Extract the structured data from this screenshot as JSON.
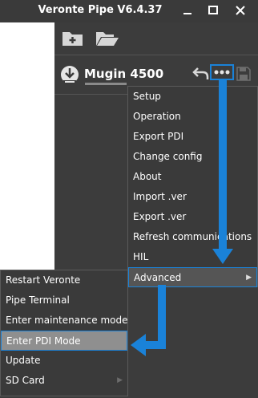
{
  "window": {
    "title": "Veronte Pipe V6.4.37",
    "controls": {
      "minimize": "minimize-icon",
      "maximize": "maximize-icon",
      "close": "close-icon"
    }
  },
  "toolbar": {
    "icons": [
      "new-folder-icon",
      "open-folder-icon"
    ]
  },
  "device": {
    "name": "Mugin 4500",
    "icon": "device-icon",
    "actions": [
      "undo-icon",
      "more-options-icon",
      "save-icon"
    ]
  },
  "main_menu": {
    "items": [
      "Setup",
      "Operation",
      "Export PDI",
      "Change config",
      "About",
      "Import .ver",
      "Export .ver",
      "Refresh communications",
      "HIL",
      "Advanced"
    ],
    "highlighted": "Advanced"
  },
  "advanced_submenu": {
    "items": [
      "Restart Veronte",
      "Pipe Terminal",
      "Enter maintenance mode",
      "Enter PDI Mode",
      "Update",
      "SD Card"
    ],
    "selected": "Enter PDI Mode"
  },
  "accent_color": "#1a82d8"
}
